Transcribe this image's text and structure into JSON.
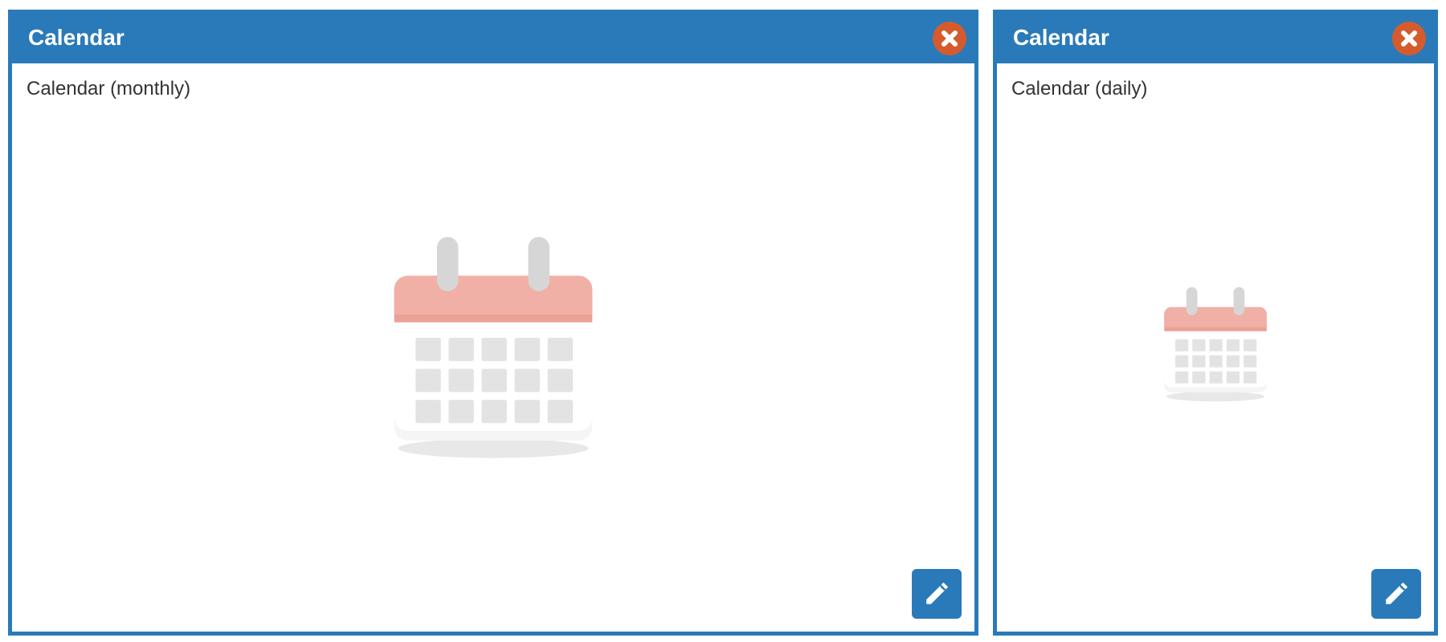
{
  "colors": {
    "header": "#2a7ab9",
    "close": "#d65b2c"
  },
  "panels": [
    {
      "title": "Calendar",
      "subtitle": "Calendar (monthly)",
      "illustration": "calendar-icon"
    },
    {
      "title": "Calendar",
      "subtitle": "Calendar (daily)",
      "illustration": "calendar-icon"
    }
  ]
}
